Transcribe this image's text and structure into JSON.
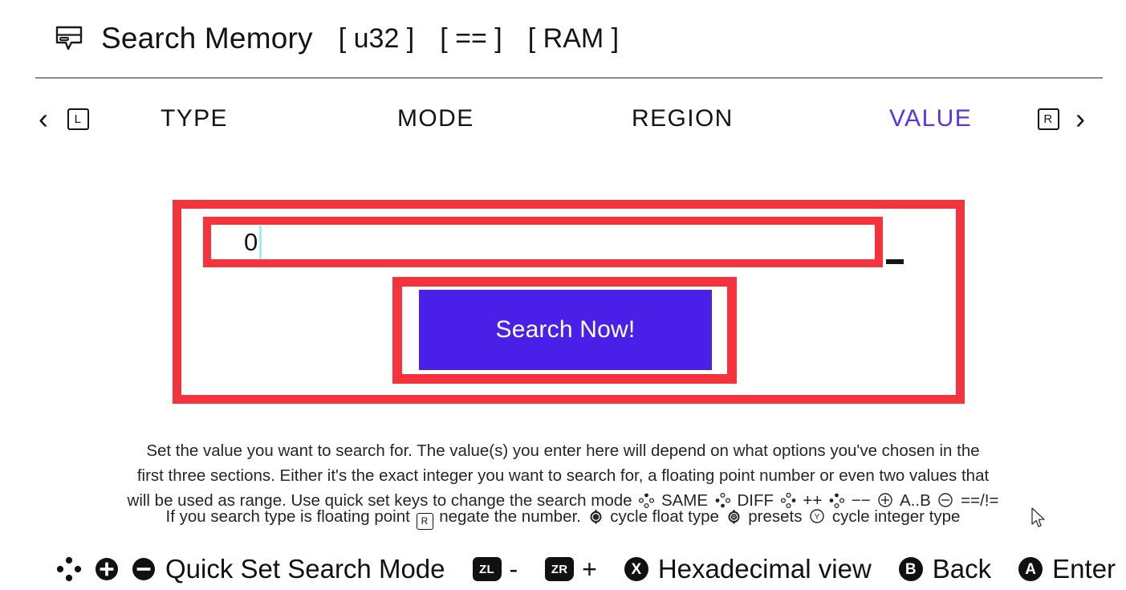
{
  "header": {
    "icon": "message-bubble-icon",
    "title": "Search Memory",
    "tags": [
      "[ u32 ]",
      "[ == ]",
      "[ RAM ]"
    ]
  },
  "section_nav": {
    "prev_chevron": "‹",
    "next_chevron": "›",
    "left_button": "L",
    "right_button": "R",
    "sections": [
      "TYPE",
      "MODE",
      "REGION",
      "VALUE"
    ],
    "active_section": "VALUE",
    "active_color": "#5a32ea"
  },
  "value_form": {
    "input_value": "0",
    "input_placeholder": "",
    "caret_color": "#9ef0f5",
    "submit_label": "Search Now!",
    "submit_color": "#4a20e8",
    "highlight_color": "#f5333c"
  },
  "help": {
    "line1": "Set the value you want to search for. The value(s) you enter here will depend on what options you've chosen in the",
    "line2": "first three sections. Either it's the exact integer you want to search for, a floating point number or even two values that",
    "line3_a": "will be used as range. Use quick set keys to change the search mode",
    "same_label": "SAME",
    "diff_label": "DIFF",
    "inc_label": "++",
    "dec_label": "−−",
    "range_label": "A..B",
    "eq_label": "==/!=",
    "line4_a": "If you search type is floating point",
    "line4_r": "R",
    "line4_b": "negate the number.",
    "line4_c": "cycle float type",
    "line4_d": "presets",
    "line4_e": "cycle integer type",
    "stick_label": "L",
    "rstick_label": "R",
    "y_label": "Y"
  },
  "bottom_bar": {
    "dpad_icon": "dpad-icon",
    "plus_icon": "plus-button-icon",
    "minus_icon": "minus-button-icon",
    "quick_set_label": "Quick Set Search Mode",
    "zl_label": "ZL",
    "zl_sign": "-",
    "zr_label": "ZR",
    "zr_sign": "+",
    "x_label": "X",
    "hex_label": "Hexadecimal view",
    "b_label": "B",
    "back_label": "Back",
    "a_label": "A",
    "enter_label": "Enter"
  }
}
